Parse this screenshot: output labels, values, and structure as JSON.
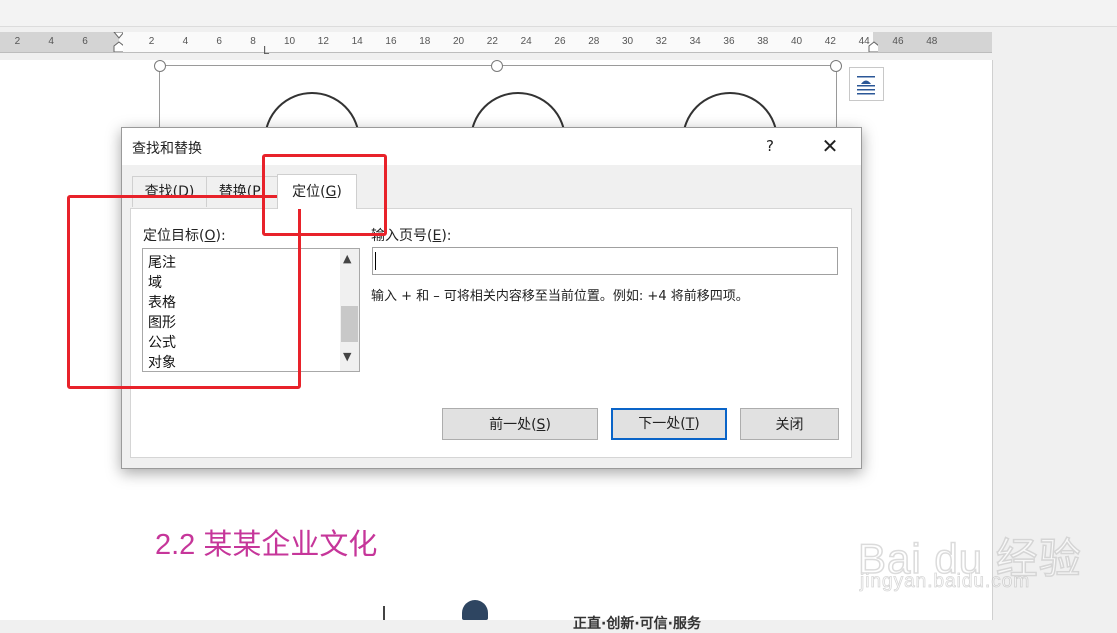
{
  "ruler": {
    "left_numbers": [
      "6",
      "4",
      "2"
    ],
    "right_numbers": [
      "2",
      "4",
      "6",
      "8",
      "10",
      "12",
      "14",
      "16",
      "18",
      "20",
      "22",
      "24",
      "26",
      "28",
      "30",
      "32",
      "34",
      "36",
      "38",
      "40",
      "42",
      "44",
      "46",
      "48"
    ],
    "tab_marker": "L"
  },
  "document": {
    "heading": "2.2 某某企业文化",
    "cut_text": "正直·创新·可信·服务"
  },
  "dialog": {
    "title": "查找和替换",
    "help": "?",
    "close": "✕",
    "tabs": {
      "find": "查找(D)",
      "replace": "替换(P)",
      "goto": "定位(G)"
    },
    "goto_what_label": "定位目标(O):",
    "goto_items": [
      "尾注",
      "域",
      "表格",
      "图形",
      "公式",
      "对象"
    ],
    "page_label": "输入页号(E):",
    "page_value": "",
    "hint": "输入 + 和 – 可将相关内容移至当前位置。例如: +4 将前移四项。",
    "buttons": {
      "prev": "前一处(S)",
      "next": "下一处(T)",
      "close": "关闭"
    }
  },
  "watermark": {
    "brand": "Bai du 经验",
    "url": "jingyan.baidu.com"
  },
  "colors": {
    "heading": "#c6369a",
    "annotation": "#e8222a",
    "focus": "#0a64c8"
  }
}
